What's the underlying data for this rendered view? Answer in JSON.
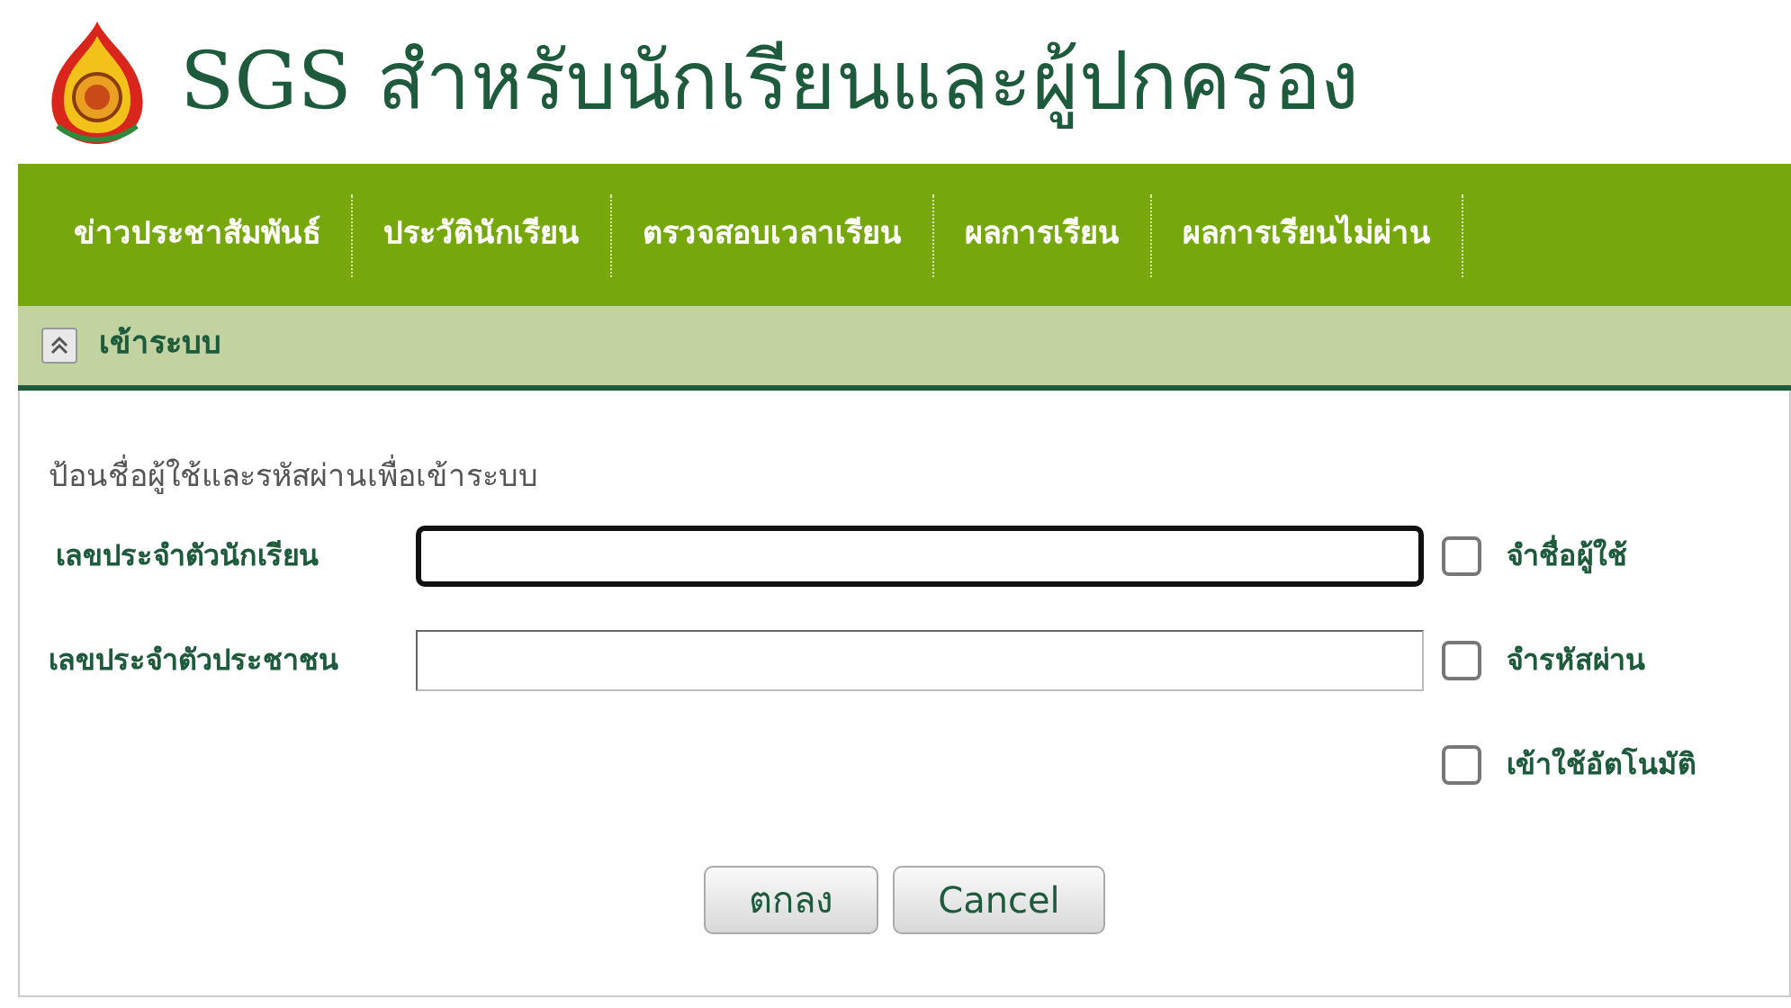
{
  "header": {
    "title": "SGS สำหรับนักเรียนและผู้ปกครอง"
  },
  "nav": [
    {
      "label": "ข่าวประชาสัมพันธ์"
    },
    {
      "label": "ประวัตินักเรียน"
    },
    {
      "label": "ตรวจสอบเวลาเรียน"
    },
    {
      "label": "ผลการเรียน"
    },
    {
      "label": "ผลการเรียนไม่ผ่าน"
    }
  ],
  "panel": {
    "title": "เข้าระบบ",
    "expanded": true
  },
  "form": {
    "instruction": "ป้อนชื่อผู้ใช้และรหัสผ่านเพื่อเข้าระบบ",
    "rows": [
      {
        "label": "เลขประจำตัวนักเรียน",
        "focused": true,
        "option": {
          "label": "จำชื่อผู้ใช้",
          "checked": false
        }
      },
      {
        "label": "เลขประจำตัวประชาชน",
        "focused": false,
        "option": {
          "label": "จำรหัสผ่าน",
          "checked": false
        }
      },
      {
        "option": {
          "label": "เข้าใช้อัตโนมัติ",
          "checked": false
        }
      }
    ],
    "buttons": [
      "ตกลง",
      "Cancel"
    ]
  }
}
